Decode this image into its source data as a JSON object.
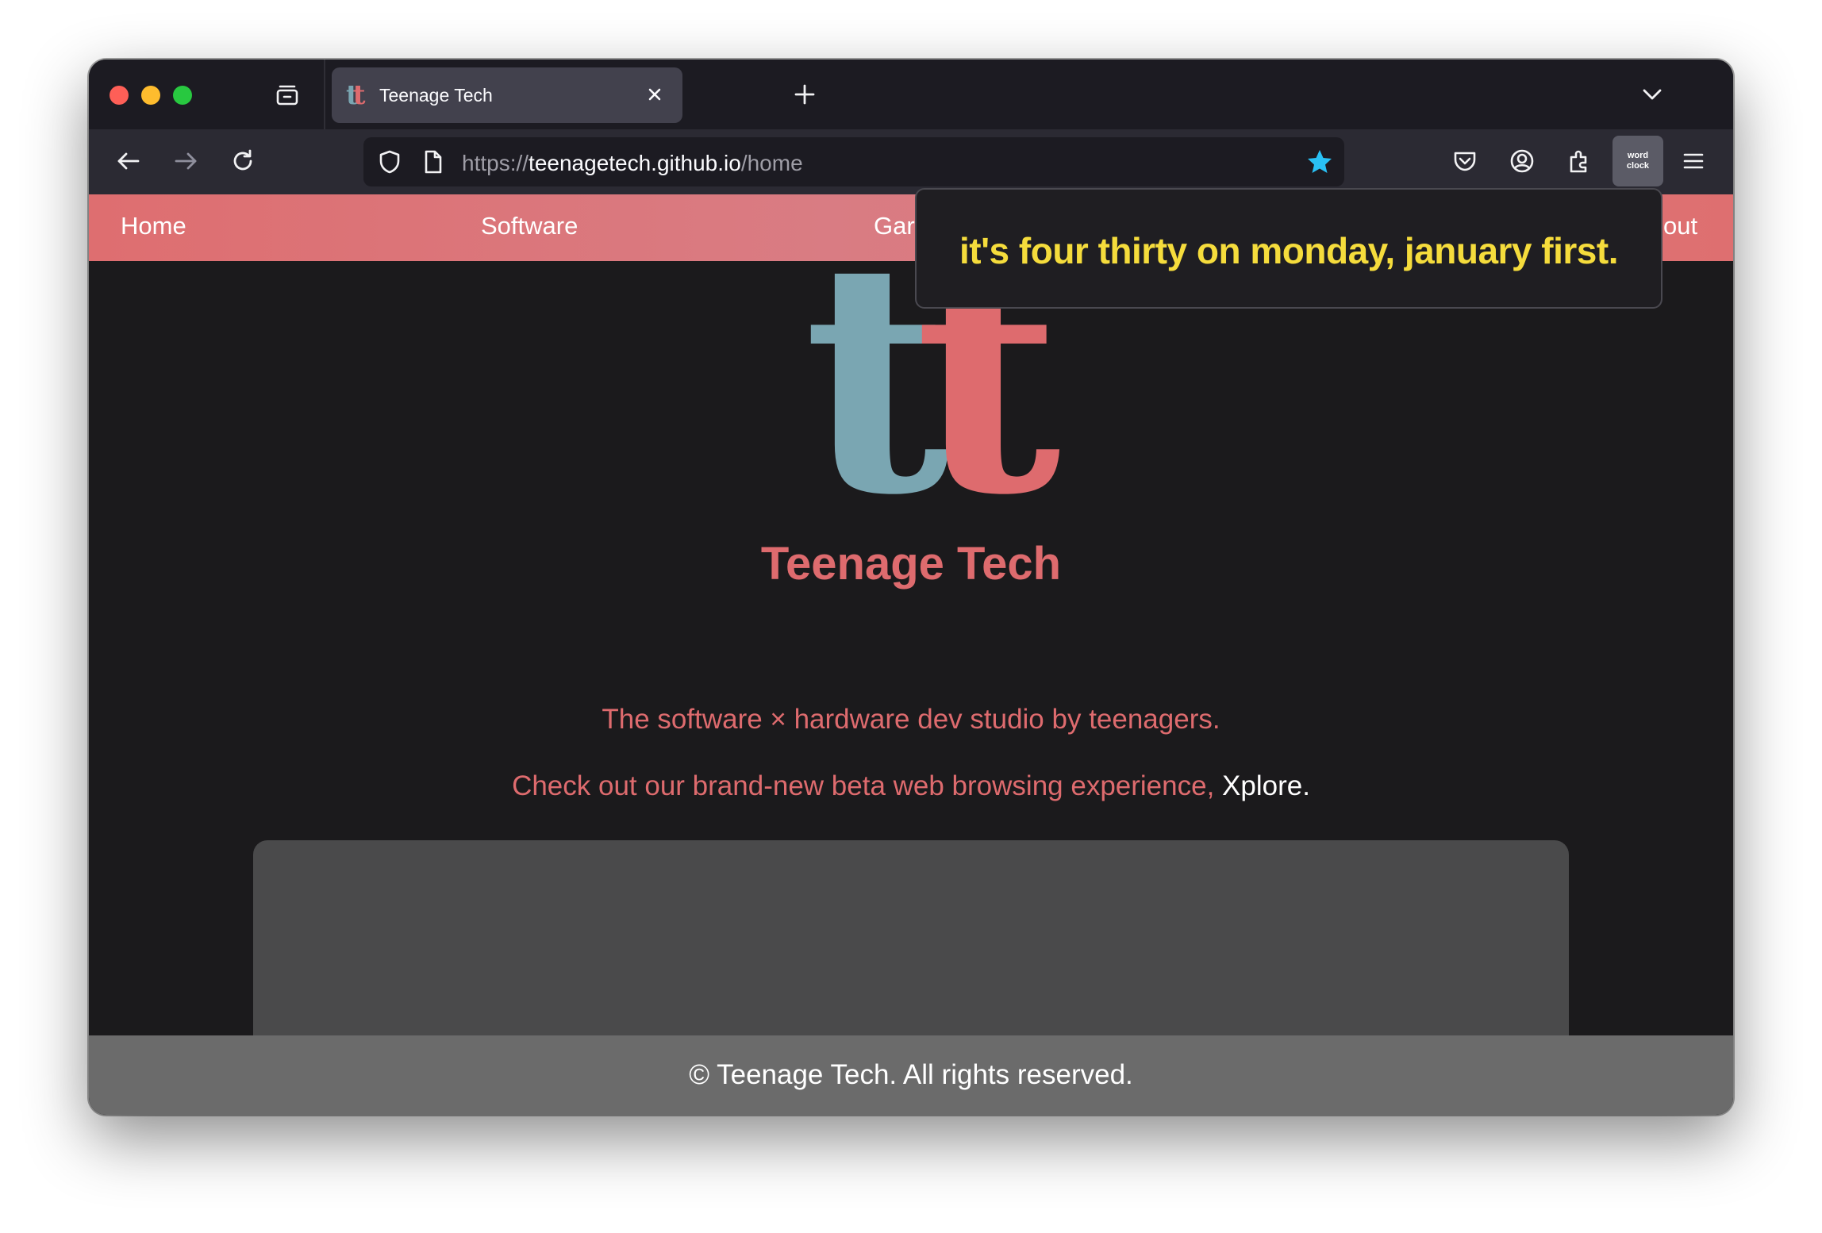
{
  "browser": {
    "tab": {
      "title": "Teenage Tech",
      "favicon_letters": [
        "t",
        "t"
      ]
    },
    "url": {
      "scheme": "https://",
      "host": "teenagetech.github.io",
      "path": "/home"
    },
    "extension": {
      "label_line1": "word",
      "label_line2": "clock"
    }
  },
  "site": {
    "nav": {
      "home": "Home",
      "software": "Software",
      "games": "Gar",
      "about": "out"
    },
    "logo_letters": [
      "t",
      "t"
    ],
    "brand": "Teenage Tech",
    "tagline": "The software × hardware dev studio by teenagers.",
    "tagline2_prefix": "Check out our brand-new beta web browsing experience, ",
    "tagline2_link": "Xplore",
    "tagline2_suffix": ".",
    "footer": "© Teenage Tech. All rights reserved."
  },
  "popup": {
    "text": "it's four thirty on monday, january first."
  },
  "colors": {
    "accent_red": "#de6b6e",
    "accent_teal": "#7aa6b2",
    "star_blue": "#29c1f5",
    "popup_yellow": "#f5dc3c"
  },
  "icons": [
    "close-icon",
    "tab-overview-icon",
    "new-tab-plus-icon",
    "list-all-tabs-chevron-icon",
    "back-arrow-icon",
    "forward-arrow-icon",
    "reload-icon",
    "tracking-protection-shield-icon",
    "page-info-icon",
    "bookmark-star-icon",
    "pocket-icon",
    "account-icon",
    "extensions-puzzle-icon",
    "app-menu-hamburger-icon"
  ]
}
